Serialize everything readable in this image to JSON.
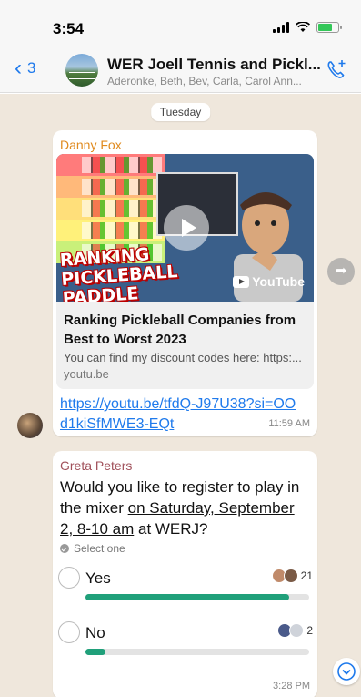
{
  "status": {
    "time": "3:54"
  },
  "header": {
    "back_count": "3",
    "title": "WER Joell Tennis and Pickl...",
    "members": "Aderonke, Beth, Bev, Carla, Carol Ann..."
  },
  "chat": {
    "day": "Tuesday",
    "messages": [
      {
        "sender": "Danny Fox",
        "preview": {
          "thumbnail_text": "RANKING PICKLEBALL PADDLE COMPANIES",
          "thumbnail_badge": "YouTube",
          "title": "Ranking Pickleball Companies from Best to Worst 2023",
          "description": "You can find my discount codes here: https:...",
          "domain": "youtu.be"
        },
        "link": "https://youtu.be/tfdQ-J97U38?si=OOd1kiSfMWE3-EQt",
        "time": "11:59 AM"
      },
      {
        "sender": "Greta Peters",
        "poll": {
          "question_start": "Would you like to register to play in the mixer ",
          "question_underlined": "on Saturday, September 2, 8-10 am",
          "question_end": " at WERJ?",
          "hint": "Select one",
          "options": [
            {
              "label": "Yes",
              "votes": "21",
              "fraction": 0.91
            },
            {
              "label": "No",
              "votes": "2",
              "fraction": 0.09
            }
          ]
        },
        "time": "3:28 PM"
      }
    ]
  },
  "colors": {
    "accent": "#1f7aec",
    "chat_bg": "#efe7dc",
    "poll_bar": "#20a07a",
    "sender1": "#e08a1e",
    "sender2": "#a0505a"
  }
}
